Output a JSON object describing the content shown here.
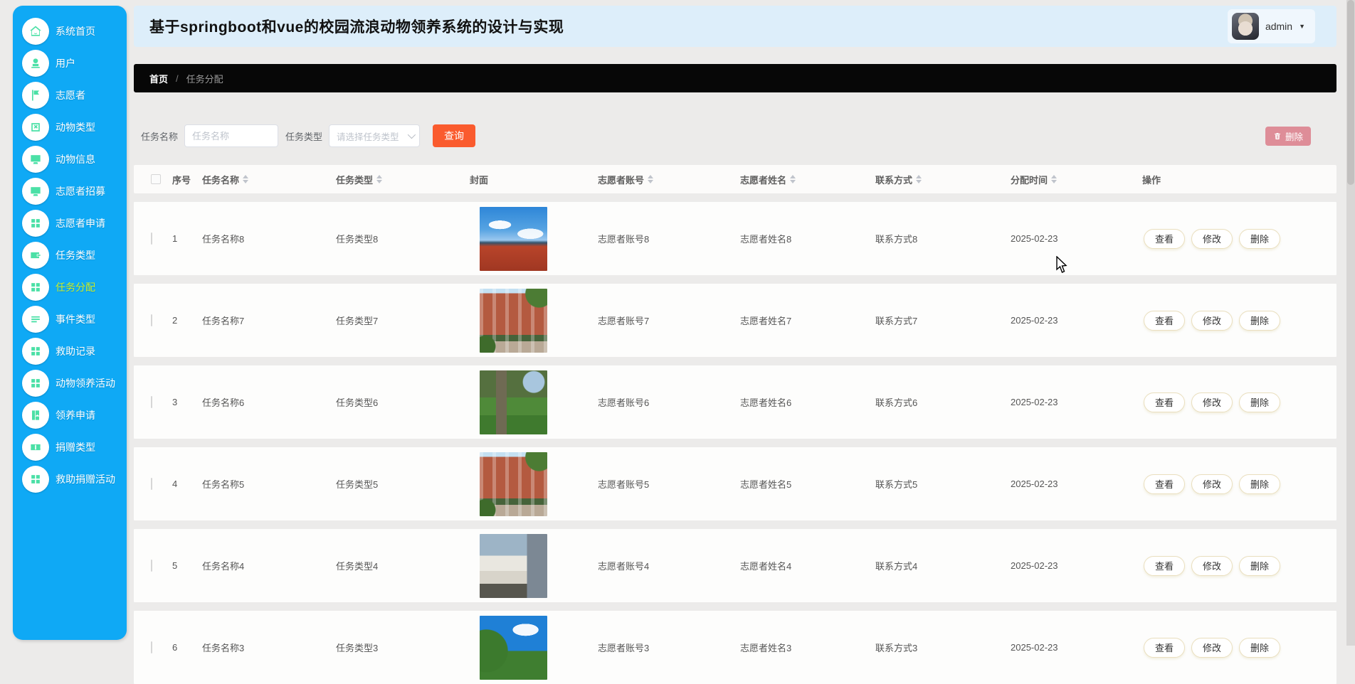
{
  "header": {
    "title": "基于springboot和vue的校园流浪动物领养系统的设计与实现",
    "user": {
      "name": "admin",
      "caret": "▼"
    }
  },
  "breadcrumb": {
    "home": "首页",
    "separator": "/",
    "current": "任务分配"
  },
  "sidebar": {
    "items": [
      {
        "label": "系统首页",
        "icon": "home-icon",
        "active": false
      },
      {
        "label": "用户",
        "icon": "user-icon",
        "active": false
      },
      {
        "label": "志愿者",
        "icon": "flag-icon",
        "active": false
      },
      {
        "label": "动物类型",
        "icon": "box-x-icon",
        "active": false
      },
      {
        "label": "动物信息",
        "icon": "monitor-icon",
        "active": false
      },
      {
        "label": "志愿者招募",
        "icon": "monitor-icon",
        "active": false
      },
      {
        "label": "志愿者申请",
        "icon": "grid-icon",
        "active": false
      },
      {
        "label": "任务类型",
        "icon": "wallet-icon",
        "active": false
      },
      {
        "label": "任务分配",
        "icon": "grid-icon",
        "active": true
      },
      {
        "label": "事件类型",
        "icon": "list-icon",
        "active": false
      },
      {
        "label": "救助记录",
        "icon": "grid-icon",
        "active": false
      },
      {
        "label": "动物领养活动",
        "icon": "grid-icon",
        "active": false
      },
      {
        "label": "领养申请",
        "icon": "book-icon",
        "active": false
      },
      {
        "label": "捐赠类型",
        "icon": "ticket-icon",
        "active": false
      },
      {
        "label": "救助捐赠活动",
        "icon": "grid-icon",
        "active": false
      }
    ],
    "colors": {
      "background": "#0fa9f5",
      "icon": "#4be0a6",
      "active_text": "#c9ee2b"
    }
  },
  "filters": {
    "task_name_label": "任务名称",
    "task_name_placeholder": "任务名称",
    "task_type_label": "任务类型",
    "task_type_placeholder": "请选择任务类型",
    "search_label": "查询",
    "batch_delete_label": "删除",
    "search_color": "#fa5b2e",
    "batch_delete_color": "#de8d98"
  },
  "table": {
    "columns": [
      {
        "label": "序号",
        "sortable": false
      },
      {
        "label": "任务名称",
        "sortable": true
      },
      {
        "label": "任务类型",
        "sortable": true
      },
      {
        "label": "封面",
        "sortable": false
      },
      {
        "label": "志愿者账号",
        "sortable": true
      },
      {
        "label": "志愿者姓名",
        "sortable": true
      },
      {
        "label": "联系方式",
        "sortable": true
      },
      {
        "label": "分配时间",
        "sortable": true
      },
      {
        "label": "操作",
        "sortable": false
      }
    ],
    "actions": {
      "view": "查看",
      "edit": "修改",
      "delete": "删除"
    },
    "rows": [
      {
        "no": "1",
        "name": "任务名称8",
        "type": "任务类型8",
        "cover": "campus-track-photo",
        "account": "志愿者账号8",
        "volunteer": "志愿者姓名8",
        "contact": "联系方式8",
        "date": "2025-02-23"
      },
      {
        "no": "2",
        "name": "任务名称7",
        "type": "任务类型7",
        "cover": "brick-building-photo",
        "account": "志愿者账号7",
        "volunteer": "志愿者姓名7",
        "contact": "联系方式7",
        "date": "2025-02-23"
      },
      {
        "no": "3",
        "name": "任务名称6",
        "type": "任务类型6",
        "cover": "campus-trees-photo",
        "account": "志愿者账号6",
        "volunteer": "志愿者姓名6",
        "contact": "联系方式6",
        "date": "2025-02-23"
      },
      {
        "no": "4",
        "name": "任务名称5",
        "type": "任务类型5",
        "cover": "brick-building-photo",
        "account": "志愿者账号5",
        "volunteer": "志愿者姓名5",
        "contact": "联系方式5",
        "date": "2025-02-23"
      },
      {
        "no": "5",
        "name": "任务名称4",
        "type": "任务类型4",
        "cover": "modern-building-photo",
        "account": "志愿者账号4",
        "volunteer": "志愿者姓名4",
        "contact": "联系方式4",
        "date": "2025-02-23"
      },
      {
        "no": "6",
        "name": "任务名称3",
        "type": "任务类型3",
        "cover": "sky-trees-photo",
        "account": "志愿者账号3",
        "volunteer": "志愿者姓名3",
        "contact": "联系方式3",
        "date": "2025-02-23"
      }
    ]
  }
}
